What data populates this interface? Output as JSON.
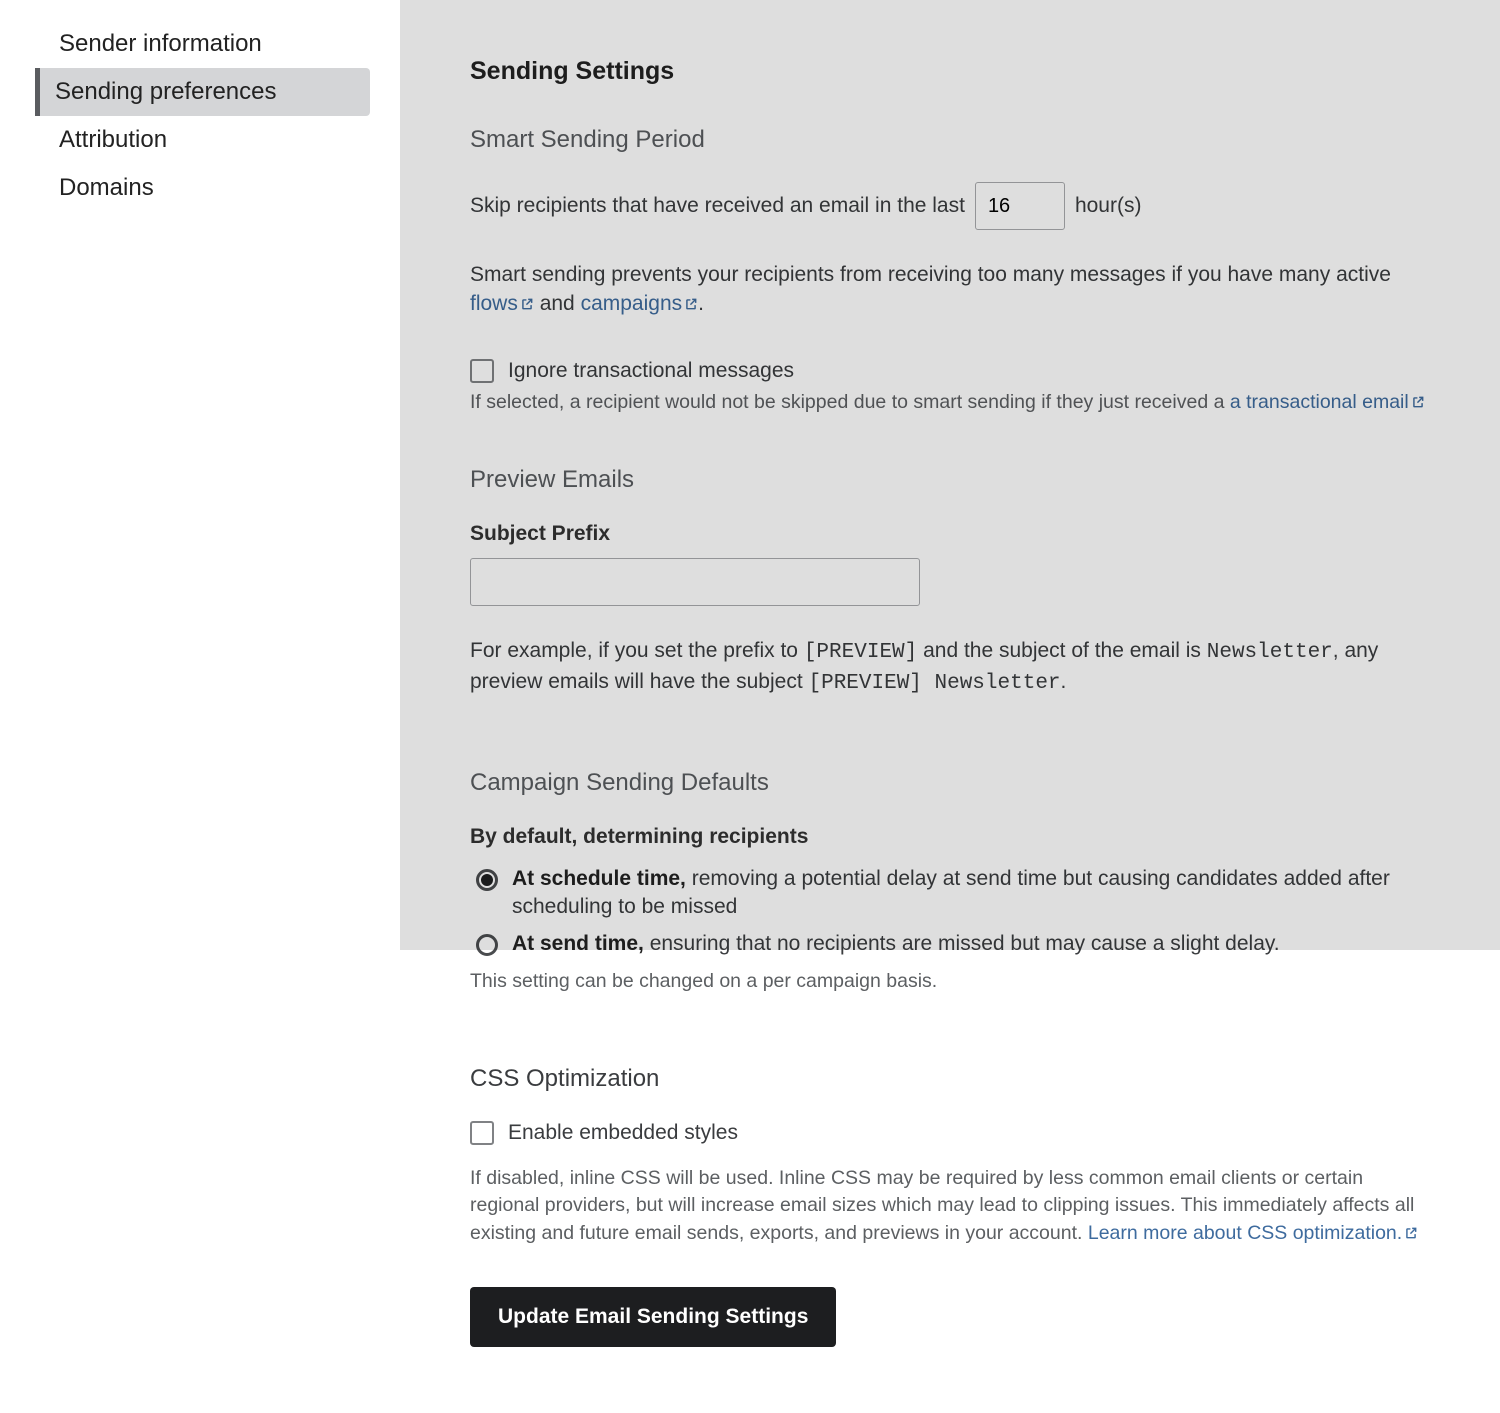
{
  "sidebar": {
    "items": [
      {
        "label": "Sender information"
      },
      {
        "label": "Sending preferences"
      },
      {
        "label": "Attribution"
      },
      {
        "label": "Domains"
      }
    ],
    "active_index": 1
  },
  "main": {
    "title": "Sending Settings",
    "smart_sending": {
      "heading": "Smart Sending Period",
      "skip_text_before": "Skip recipients that have received an email in the last",
      "hours_value": "16",
      "skip_text_after": "hour(s)",
      "desc_prefix": "Smart sending prevents your recipients from receiving too many messages if you have many active ",
      "flows_link": "flows",
      "desc_and": " and ",
      "campaigns_link": "campaigns",
      "desc_period": ".",
      "ignore_checkbox_label": "Ignore transactional messages",
      "ignore_helper_prefix": "If selected, a recipient would not be skipped due to smart sending if they just received a ",
      "transactional_link": "a transactional email"
    },
    "preview": {
      "heading": "Preview Emails",
      "subject_prefix_label": "Subject Prefix",
      "subject_prefix_value": "",
      "example_prefix": "For example, if you set the prefix to ",
      "example_mono1": "[PREVIEW]",
      "example_mid": " and the subject of the email is ",
      "example_mono2": "Newsletter",
      "example_after": ", any preview emails will have the subject ",
      "example_mono3": "[PREVIEW] Newsletter",
      "example_period": "."
    },
    "campaign_defaults": {
      "heading": "Campaign Sending Defaults",
      "by_default_label": "By default, determining recipients",
      "opt1_bold": "At schedule time,",
      "opt1_rest": " removing a potential delay at send time but causing candidates added after scheduling to be missed",
      "opt2_bold": "At send time,",
      "opt2_rest": " ensuring that no recipients are missed but may cause a slight delay.",
      "selected": 0,
      "note": "This setting can be changed on a per campaign basis."
    },
    "css_opt": {
      "heading": "CSS Optimization",
      "checkbox_label": "Enable embedded styles",
      "helper_prefix": "If disabled, inline CSS will be used. Inline CSS may be required by less common email clients or certain regional providers, but will increase email sizes which may lead to clipping issues. This immediately affects all existing and future email sends, exports, and previews in your account. ",
      "learn_link": "Learn more about CSS optimization."
    },
    "update_button": "Update Email Sending Settings"
  }
}
